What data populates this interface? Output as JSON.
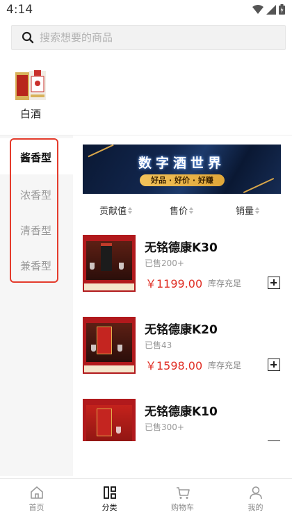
{
  "status_bar": {
    "time": "4:14"
  },
  "search": {
    "placeholder": "搜索想要的商品",
    "value": ""
  },
  "top_category": {
    "label": "白酒"
  },
  "sidebar": {
    "items": [
      {
        "label": "酱香型",
        "active": true
      },
      {
        "label": "浓香型",
        "active": false
      },
      {
        "label": "清香型",
        "active": false
      },
      {
        "label": "兼香型",
        "active": false
      }
    ]
  },
  "banner": {
    "title": "数字酒世界",
    "subtitle": "好品 · 好价 · 好赚"
  },
  "sort": {
    "items": [
      "贡献值",
      "售价",
      "销量"
    ]
  },
  "products": [
    {
      "name": "无铭德康K30",
      "sold": "已售200+",
      "price": "￥1199.00",
      "stock": "库存充足"
    },
    {
      "name": "无铭德康K20",
      "sold": "已售43",
      "price": "￥1598.00",
      "stock": "库存充足"
    },
    {
      "name": "无铭德康K10",
      "sold": "已售300+",
      "price": "",
      "stock": ""
    }
  ],
  "tabs": [
    {
      "label": "首页",
      "icon": "home-icon",
      "active": false
    },
    {
      "label": "分类",
      "icon": "category-icon",
      "active": true
    },
    {
      "label": "购物车",
      "icon": "cart-icon",
      "active": false
    },
    {
      "label": "我的",
      "icon": "profile-icon",
      "active": false
    }
  ],
  "colors": {
    "accent_red": "#e02e24",
    "highlight_border": "#e43b2c",
    "sidebar_bg": "#f6f6f6"
  }
}
